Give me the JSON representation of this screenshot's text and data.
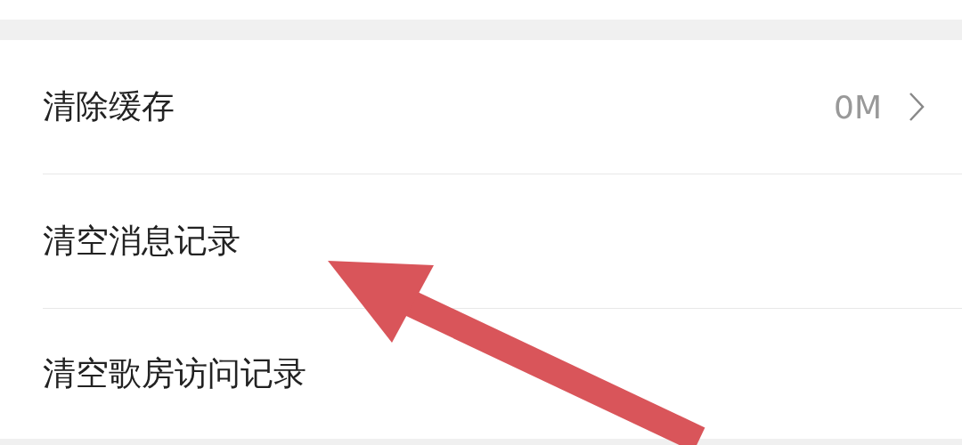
{
  "rows": [
    {
      "label": "清除缓存",
      "kind": "value",
      "value": "0M"
    },
    {
      "label": "清空消息记录",
      "kind": "plain"
    },
    {
      "label": "清空歌房访问记录",
      "kind": "plain"
    }
  ],
  "overlay": {
    "kind": "arrow"
  }
}
